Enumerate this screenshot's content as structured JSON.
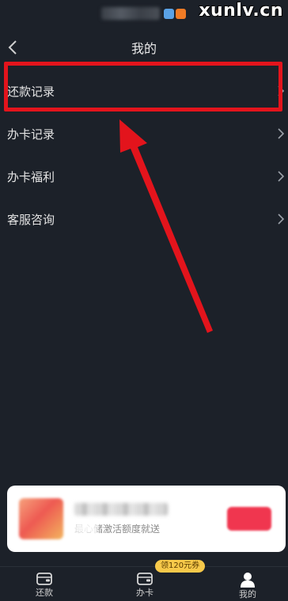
{
  "status_bar": {
    "watermark": "xunlv.cn"
  },
  "header": {
    "title": "我的"
  },
  "menu": {
    "items": [
      {
        "label": "还款记录"
      },
      {
        "label": "办卡记录"
      },
      {
        "label": "办卡福利"
      },
      {
        "label": "客服咨询"
      }
    ]
  },
  "promo": {
    "subtitle": "最心储激活额度就送"
  },
  "bottom_nav": {
    "items": [
      {
        "label": "还款",
        "icon": "wallet-icon"
      },
      {
        "label": "办卡",
        "icon": "card-icon"
      },
      {
        "label": "我的",
        "icon": "person-icon"
      }
    ],
    "badge": "领120元券"
  },
  "colors": {
    "background": "#1c2129",
    "highlight": "#e3141c",
    "badge": "#f7c94a"
  }
}
